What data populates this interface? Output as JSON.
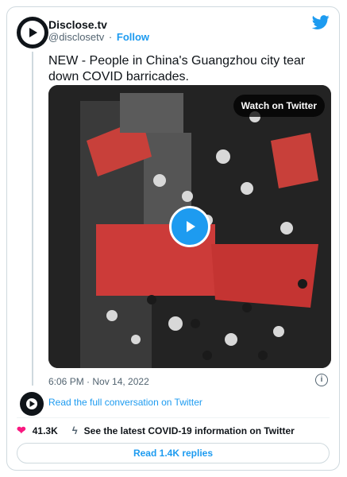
{
  "author": {
    "name": "Disclose.tv",
    "handle": "@disclosetv",
    "separator": "·",
    "follow_label": "Follow"
  },
  "tweet": {
    "text": "NEW - People in China's Guangzhou city tear down COVID barricades."
  },
  "media": {
    "watch_label": "Watch on Twitter"
  },
  "meta": {
    "timestamp": "6:06 PM · Nov 14, 2022",
    "info_glyph": "i"
  },
  "conversation": {
    "read_full_label": "Read the full conversation on Twitter"
  },
  "actions": {
    "like_count": "41.3K",
    "covid_label": "See the latest COVID-19 information on Twitter"
  },
  "replies": {
    "label": "Read 1.4K replies"
  },
  "colors": {
    "accent": "#1d9bf0",
    "like": "#f91880",
    "text": "#0f1419",
    "muted": "#536471"
  }
}
